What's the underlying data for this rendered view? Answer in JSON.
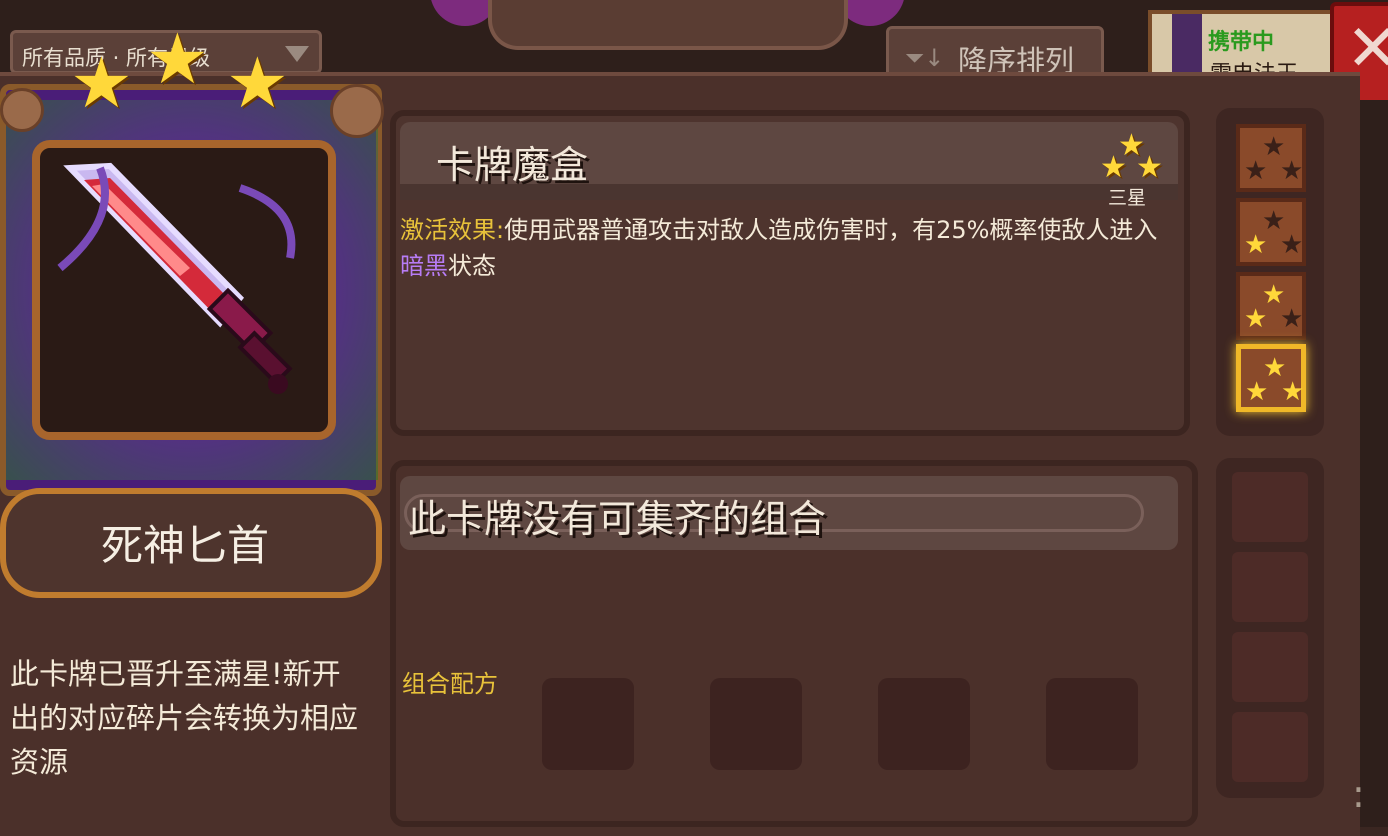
{
  "header": {
    "filter_text": "所有品质 · 所有星级",
    "sort_label": "降序排列",
    "carry_label": "携带中",
    "carry_sub": "雷电法王"
  },
  "card": {
    "stars": 3,
    "name": "死神匕首",
    "note": "此卡牌已晋升至满星!新开出的对应碎片会转换为相应资源"
  },
  "effect": {
    "title": "卡牌魔盒",
    "tier_label": "三星",
    "label": "激活效果:",
    "text_before": "使用武器普通攻击对敌人造成伤害时，有25%概率使敌人进入",
    "status": "暗黑",
    "text_after": "状态"
  },
  "tiers": [
    {
      "stars_on": 0,
      "selected": false
    },
    {
      "stars_on": 1,
      "selected": false
    },
    {
      "stars_on": 2,
      "selected": false
    },
    {
      "stars_on": 3,
      "selected": true
    }
  ],
  "combo": {
    "title": "此卡牌没有可集齐的组合",
    "recipe_label": "组合配方",
    "slots": 4
  },
  "colors": {
    "gold_label": "#e8c23a",
    "purple_status": "#b77cf5",
    "panel_bg": "#4e342e",
    "carry_green": "#2a9a1e",
    "close_red": "#b62020"
  },
  "icons": {
    "close": "close-icon",
    "sort": "sort-descending-icon",
    "star": "star-icon",
    "weapon": "dagger-icon"
  }
}
